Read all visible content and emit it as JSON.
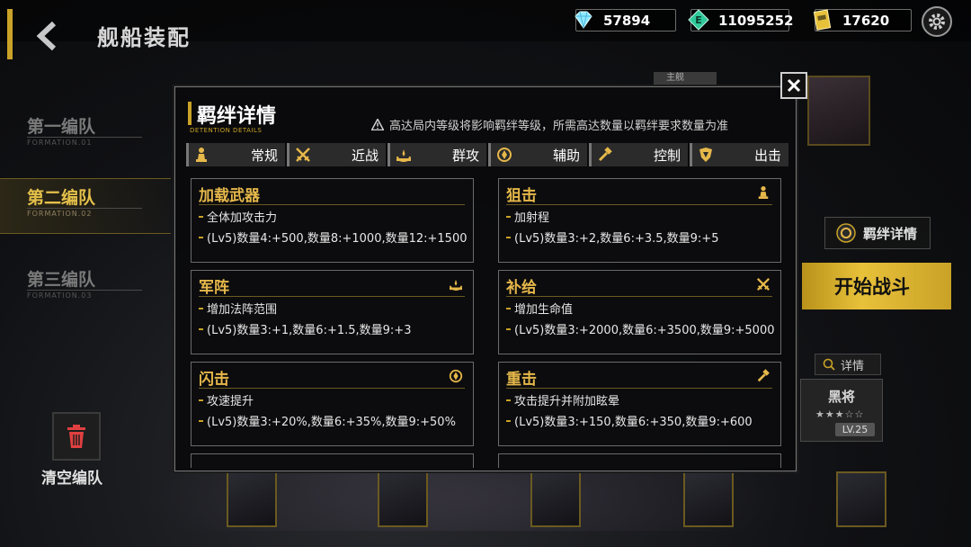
{
  "header": {
    "page_title": "舰船装配"
  },
  "currencies": [
    {
      "icon": "diamond-icon",
      "value": "57894"
    },
    {
      "icon": "e-coin-icon",
      "value": "11095252"
    },
    {
      "icon": "ticket-icon",
      "value": "17620"
    }
  ],
  "formations": [
    {
      "name": "第一编队",
      "sub": "FORMATION.01"
    },
    {
      "name": "第二编队",
      "sub": "FORMATION.02"
    },
    {
      "name": "第三编队",
      "sub": "FORMATION.03"
    }
  ],
  "sidebar": {
    "clear_label": "清空编队"
  },
  "right_panel": {
    "captain_label": "主舰",
    "bond_detail_label": "羁绊详情",
    "start_label": "开始战斗",
    "detail_label": "详情",
    "ship_name": "黑将",
    "ship_stars": "★★★☆☆",
    "ship_level": "LV.25"
  },
  "modal": {
    "title": "羁绊详情",
    "subtitle": "DETENTION DETAILS",
    "notice": "高达局内等级将影响羁绊等级，所需高达数量以羁绊要求数量为准",
    "tabs": [
      {
        "label": "常规",
        "icon": "pawn-icon"
      },
      {
        "label": "近战",
        "icon": "crossed-swords-icon"
      },
      {
        "label": "群攻",
        "icon": "burst-icon"
      },
      {
        "label": "辅助",
        "icon": "support-icon"
      },
      {
        "label": "控制",
        "icon": "hammer-icon"
      },
      {
        "label": "出击",
        "icon": "shield-icon"
      }
    ],
    "cards": [
      {
        "title": "加载武器",
        "desc": "全体加攻击力",
        "stats": "(Lv5)数量4:+500,数量8:+1000,数量12:+1500",
        "icon": ""
      },
      {
        "title": "狙击",
        "desc": "加射程",
        "stats": "(Lv5)数量3:+2,数量6:+3.5,数量9:+5",
        "icon": "pawn-icon"
      },
      {
        "title": "军阵",
        "desc": "增加法阵范围",
        "stats": "(Lv5)数量3:+1,数量6:+1.5,数量9:+3",
        "icon": "burst-icon"
      },
      {
        "title": "补给",
        "desc": "增加生命值",
        "stats": "(Lv5)数量3:+2000,数量6:+3500,数量9:+5000",
        "icon": "crossed-swords-icon"
      },
      {
        "title": "闪击",
        "desc": "攻速提升",
        "stats": "(Lv5)数量3:+20%,数量6:+35%,数量9:+50%",
        "icon": "support-icon"
      },
      {
        "title": "重击",
        "desc": "攻击提升并附加眩晕",
        "stats": "(Lv5)数量3:+150,数量6:+350,数量9:+600",
        "icon": "hammer-icon"
      }
    ]
  },
  "colors": {
    "accent_gold": "#c9a227",
    "card_title": "#e6b84a",
    "start_button": "#e8c13a"
  }
}
